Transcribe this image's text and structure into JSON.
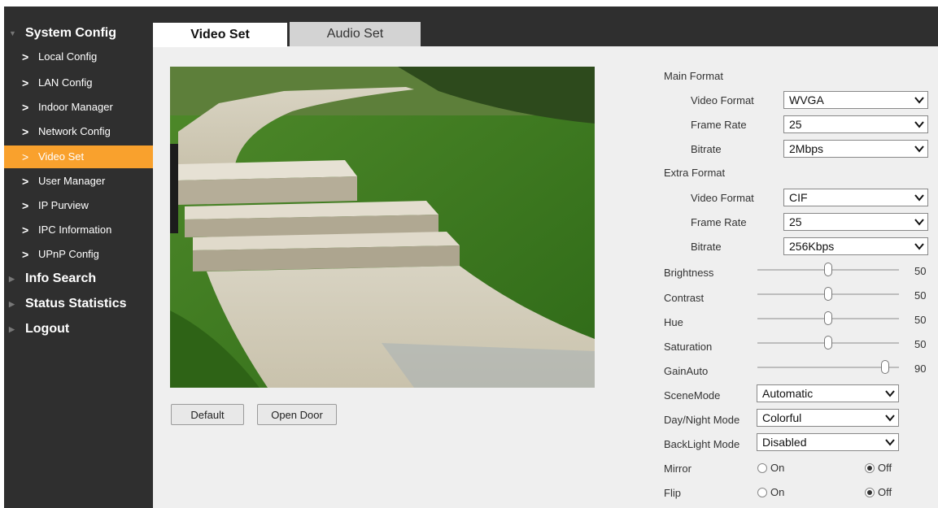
{
  "sidebar": {
    "system_config": "System Config",
    "items": [
      {
        "label": "Local Config"
      },
      {
        "label": "LAN Config"
      },
      {
        "label": "Indoor Manager"
      },
      {
        "label": "Network Config"
      },
      {
        "label": "Video Set"
      },
      {
        "label": "User Manager"
      },
      {
        "label": "IP Purview"
      },
      {
        "label": "IPC Information"
      },
      {
        "label": "UPnP Config"
      }
    ],
    "info_search": "Info Search",
    "status_statistics": "Status Statistics",
    "logout": "Logout"
  },
  "tabs": {
    "video_set": "Video Set",
    "audio_set": "Audio Set"
  },
  "buttons": {
    "default": "Default",
    "open_door": "Open Door"
  },
  "main_format": {
    "title": "Main Format",
    "video_format_label": "Video Format",
    "video_format": "WVGA",
    "frame_rate_label": "Frame Rate",
    "frame_rate": "25",
    "bitrate_label": "Bitrate",
    "bitrate": "2Mbps"
  },
  "extra_format": {
    "title": "Extra Format",
    "video_format_label": "Video Format",
    "video_format": "CIF",
    "frame_rate_label": "Frame Rate",
    "frame_rate": "25",
    "bitrate_label": "Bitrate",
    "bitrate": "256Kbps"
  },
  "image": {
    "brightness_label": "Brightness",
    "brightness": "50",
    "contrast_label": "Contrast",
    "contrast": "50",
    "hue_label": "Hue",
    "hue": "50",
    "saturation_label": "Saturation",
    "saturation": "50",
    "gain_label": "GainAuto",
    "gain": "90"
  },
  "modes": {
    "scene_label": "SceneMode",
    "scene": "Automatic",
    "daynight_label": "Day/Night Mode",
    "daynight": "Colorful",
    "backlight_label": "BackLight Mode",
    "backlight": "Disabled"
  },
  "mirror": {
    "label": "Mirror",
    "on": "On",
    "off": "Off",
    "selected": "Off"
  },
  "flip": {
    "label": "Flip",
    "on": "On",
    "off": "Off",
    "selected": "Off"
  },
  "colors": {
    "sidebar_bg": "#2f2f2f",
    "accent": "#f9a12d",
    "panel_bg": "#efefef"
  }
}
